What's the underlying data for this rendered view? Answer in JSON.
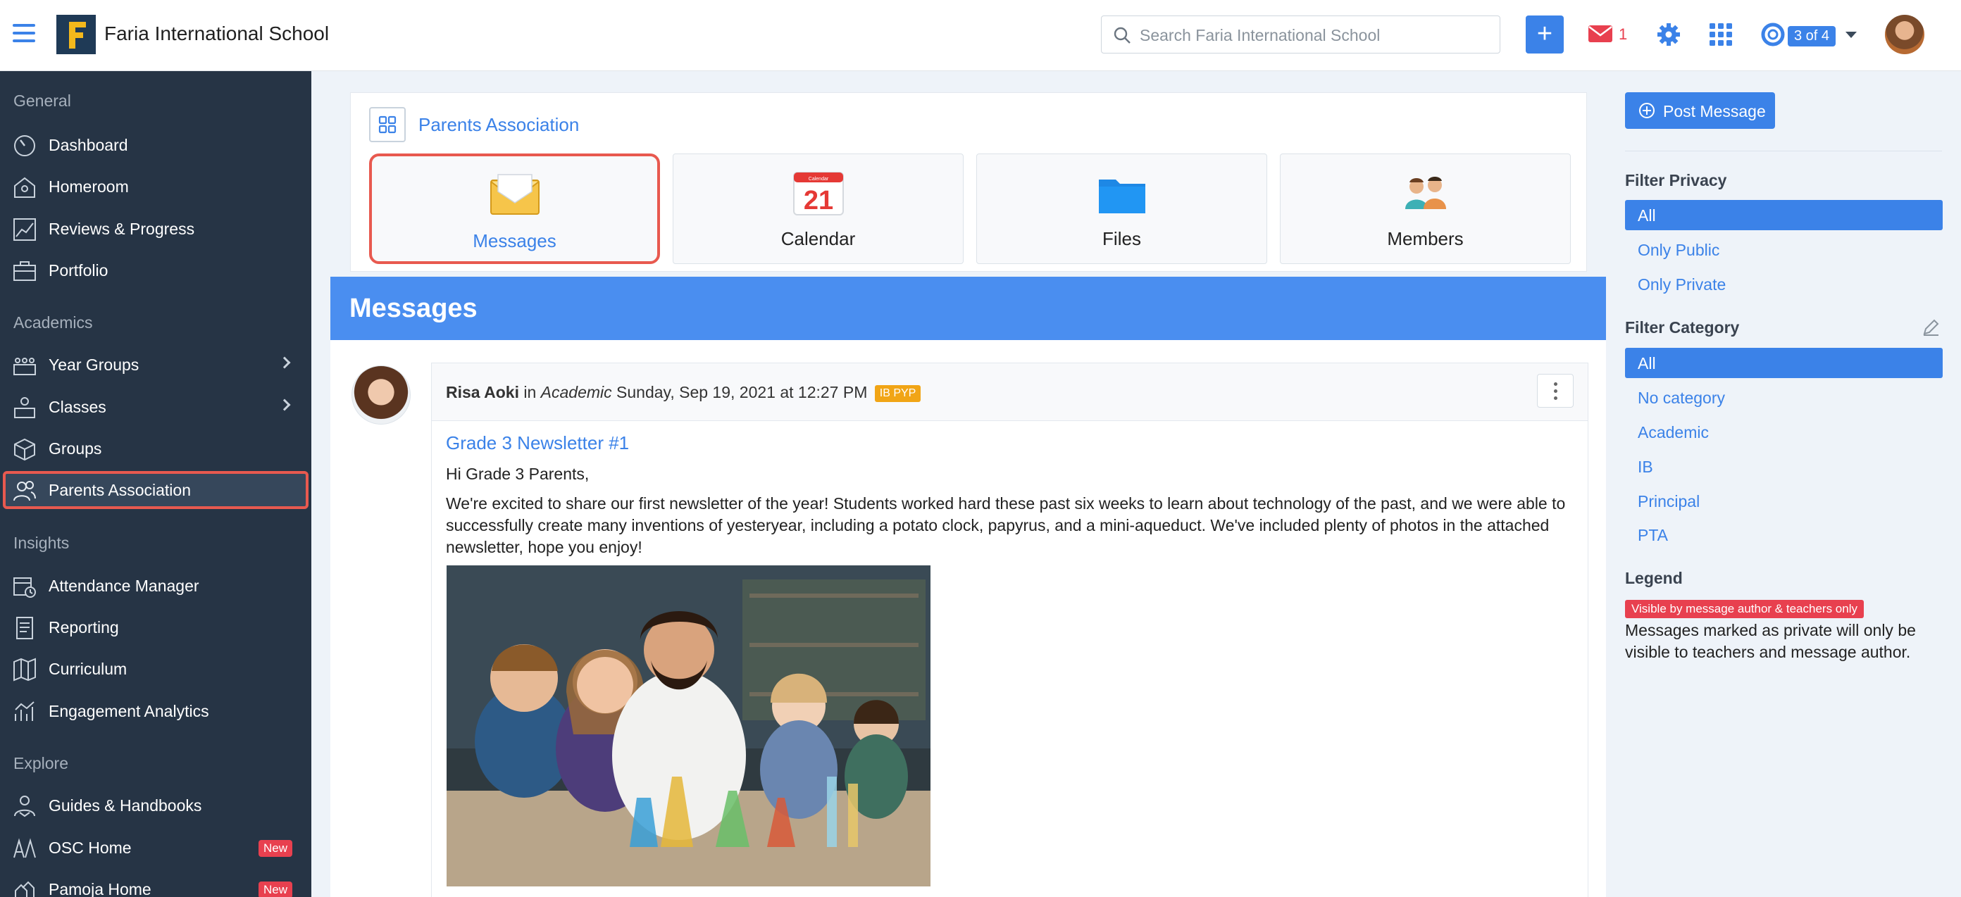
{
  "header": {
    "school_name": "Faria International School",
    "logo_letter": "F",
    "search_placeholder": "Search Faria International School",
    "add_label": "+",
    "mail_count": "1",
    "profile_switch": "3 of 4"
  },
  "sidebar": {
    "sections": {
      "general": "General",
      "academics": "Academics",
      "insights": "Insights",
      "explore": "Explore"
    },
    "items": [
      {
        "label": "Dashboard",
        "icon": "dashboard-icon"
      },
      {
        "label": "Homeroom",
        "icon": "homeroom-icon"
      },
      {
        "label": "Reviews & Progress",
        "icon": "chart-icon"
      },
      {
        "label": "Portfolio",
        "icon": "briefcase-icon"
      },
      {
        "label": "Year Groups",
        "icon": "year-groups-icon"
      },
      {
        "label": "Classes",
        "icon": "classes-icon"
      },
      {
        "label": "Groups",
        "icon": "cube-icon"
      },
      {
        "label": "Parents Association",
        "icon": "people-icon"
      },
      {
        "label": "Attendance Manager",
        "icon": "calendar-clock-icon"
      },
      {
        "label": "Reporting",
        "icon": "document-icon"
      },
      {
        "label": "Curriculum",
        "icon": "map-icon"
      },
      {
        "label": "Engagement Analytics",
        "icon": "analytics-icon"
      },
      {
        "label": "Guides & Handbooks",
        "icon": "guides-icon"
      },
      {
        "label": "OSC Home",
        "icon": "osc-icon"
      },
      {
        "label": "Pamoja Home",
        "icon": "pamoja-icon"
      }
    ],
    "new_badge": "New"
  },
  "group": {
    "title": "Parents Association",
    "tiles": [
      {
        "label": "Messages",
        "icon": "envelope-icon"
      },
      {
        "label": "Calendar",
        "icon": "calendar-icon"
      },
      {
        "label": "Files",
        "icon": "folder-icon"
      },
      {
        "label": "Members",
        "icon": "members-icon"
      }
    ],
    "calendar_day": "21",
    "calendar_month": "Calendar"
  },
  "messages": {
    "heading": "Messages",
    "post": {
      "author": "Risa Aoki",
      "in_word": " in ",
      "category": "Academic",
      "date": " Sunday, Sep 19, 2021 at 12:27 PM",
      "tag": "IB PYP",
      "title": "Grade 3 Newsletter #1",
      "greeting": "Hi Grade 3 Parents,",
      "body": "We're excited to share our first newsletter of the year! Students worked hard these past six weeks to learn about technology of the past, and we were able to successfully create many inventions of yesteryear, including a potato clock, papyrus, and a mini-aqueduct. We've included plenty of photos in the attached newsletter, hope you enjoy!"
    }
  },
  "right_panel": {
    "post_button": "Post Message",
    "filter_privacy": {
      "heading": "Filter Privacy",
      "options": [
        "All",
        "Only Public",
        "Only Private"
      ]
    },
    "filter_category": {
      "heading": "Filter Category",
      "options": [
        "All",
        "No category",
        "Academic",
        "IB",
        "Principal",
        "PTA"
      ]
    },
    "legend": {
      "heading": "Legend",
      "badge": "Visible by message author & teachers only",
      "text": "Messages marked as private will only be visible to teachers and message author."
    }
  },
  "colors": {
    "accent": "#3b82e8",
    "sidebar_bg": "#263445",
    "highlight": "#e8594f",
    "danger": "#e8404f",
    "tag": "#f1a516"
  }
}
